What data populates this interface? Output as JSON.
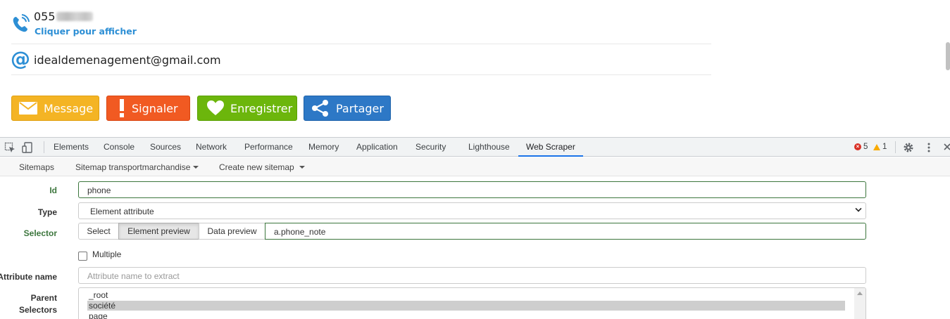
{
  "contact": {
    "phone_prefix": "055",
    "phone_reveal_link": "Cliquer pour afficher",
    "email": "idealdemenagement@gmail.com"
  },
  "actions": {
    "message_label": "Message",
    "report_label": "Signaler",
    "save_label": "Enregistrer",
    "share_label": "Partager"
  },
  "devtools": {
    "tabs": [
      {
        "label": "Elements"
      },
      {
        "label": "Console"
      },
      {
        "label": "Sources"
      },
      {
        "label": "Network"
      },
      {
        "label": "Performance"
      },
      {
        "label": "Memory"
      },
      {
        "label": "Application"
      },
      {
        "label": "Security"
      },
      {
        "label": "Lighthouse"
      },
      {
        "label": "Web Scraper"
      }
    ],
    "active_tab": "Web Scraper",
    "error_count": "5",
    "warning_count": "1"
  },
  "webscraper": {
    "nav": {
      "sitemaps": "Sitemaps",
      "sitemap_current": "Sitemap transportmarchandise",
      "create_new": "Create new sitemap"
    },
    "form": {
      "id_label": "Id",
      "id_value": "phone",
      "type_label": "Type",
      "type_value": "Element attribute",
      "selector_label": "Selector",
      "select_button": "Select",
      "element_preview_button": "Element preview",
      "data_preview_button": "Data preview",
      "selector_value": "a.phone_note",
      "multiple_label": "Multiple",
      "multiple_checked": false,
      "attribute_name_label": "Attribute name",
      "attribute_name_placeholder": "Attribute name to extract",
      "parent_selectors_label_line1": "Parent",
      "parent_selectors_label_line2": "Selectors",
      "parent_selectors_options": [
        "_root",
        "société",
        "page"
      ],
      "parent_selectors_selected": "société"
    }
  },
  "colors": {
    "message": "#f4b424",
    "report": "#f15a22",
    "save": "#6cb60c",
    "share": "#2d78c6",
    "link": "#2d8fd5",
    "valid_green": "#3c763d",
    "devtools_accent": "#1a73e8"
  }
}
